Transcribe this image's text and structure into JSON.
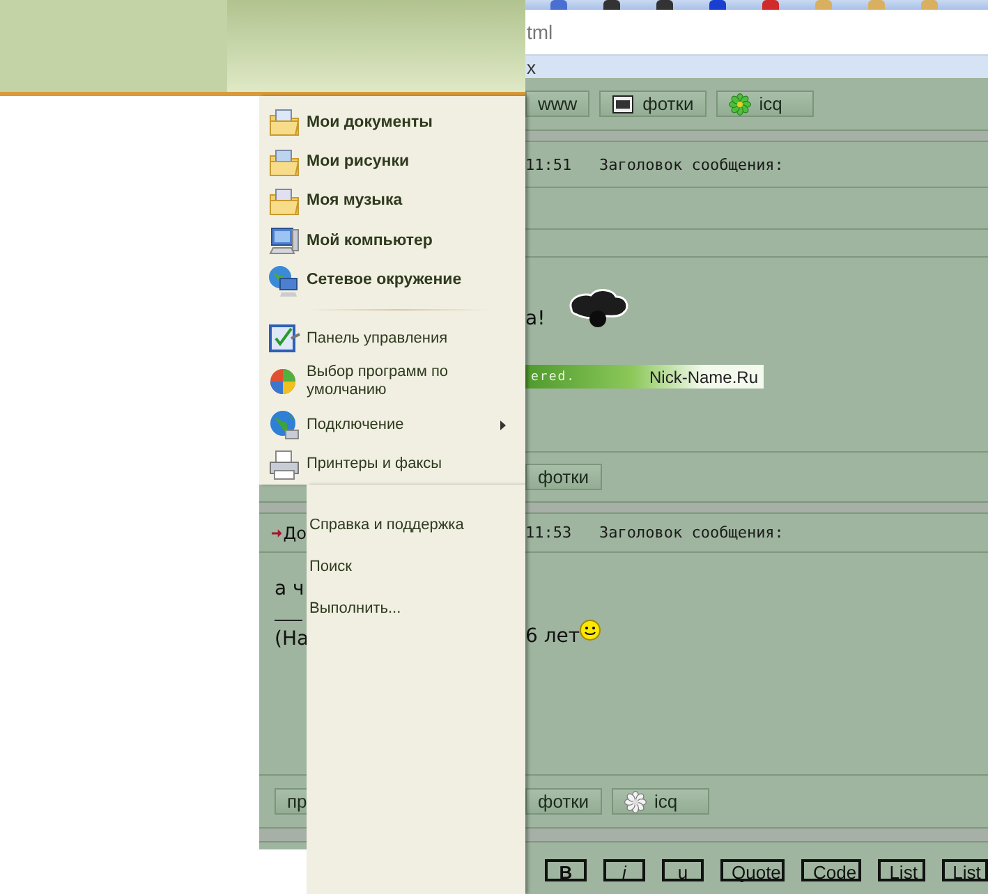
{
  "start_menu": {
    "places": [
      {
        "label": "Мои документы"
      },
      {
        "label": "Мои рисунки"
      },
      {
        "label": "Моя музыка"
      },
      {
        "label": "Мой компьютер"
      },
      {
        "label": "Сетевое окружение"
      }
    ],
    "system": [
      {
        "label": "Панель управления",
        "submenu": false
      },
      {
        "label": "Выбор программ по умолчанию",
        "submenu": false
      },
      {
        "label": "Подключение",
        "submenu": true
      },
      {
        "label": "Принтеры и факсы",
        "submenu": false
      }
    ],
    "tools": [
      {
        "label": "Справка и поддержка"
      },
      {
        "label": "Поиск"
      },
      {
        "label": "Выполнить..."
      }
    ]
  },
  "browser": {
    "address_text": "tml",
    "links_text": "x"
  },
  "forum": {
    "top_buttons": [
      {
        "kind": "plain",
        "label": "www"
      },
      {
        "kind": "photo",
        "label": "фотки"
      },
      {
        "kind": "icq",
        "online": true,
        "label": "icq"
      }
    ],
    "posts": [
      {
        "time": "11:51",
        "subject_label": "Заголовок сообщения:",
        "text": "а!",
        "banner_left": "ered.",
        "banner_right": "Nick-Name.Ru",
        "buttons": [
          {
            "kind": "plain",
            "label": "фотки"
          }
        ]
      },
      {
        "author": "До",
        "time": "11:53",
        "subject_label": "Заголовок сообщения:",
        "text_left": "а ч",
        "signature_left": "(На",
        "signature_right": "6 лет",
        "left_buttons": [
          {
            "label": "пр"
          }
        ],
        "buttons": [
          {
            "kind": "plain",
            "label": "фотки"
          },
          {
            "kind": "icq",
            "online": false,
            "label": "icq"
          }
        ]
      }
    ],
    "editor_buttons": [
      {
        "kind": "bold",
        "label": "B"
      },
      {
        "kind": "italic",
        "label": "i"
      },
      {
        "kind": "underline",
        "label": "u"
      },
      {
        "kind": "plain",
        "label": "Quote"
      },
      {
        "kind": "plain",
        "label": "Code"
      },
      {
        "kind": "plain",
        "label": "List"
      },
      {
        "kind": "plain",
        "label": "List"
      }
    ]
  }
}
